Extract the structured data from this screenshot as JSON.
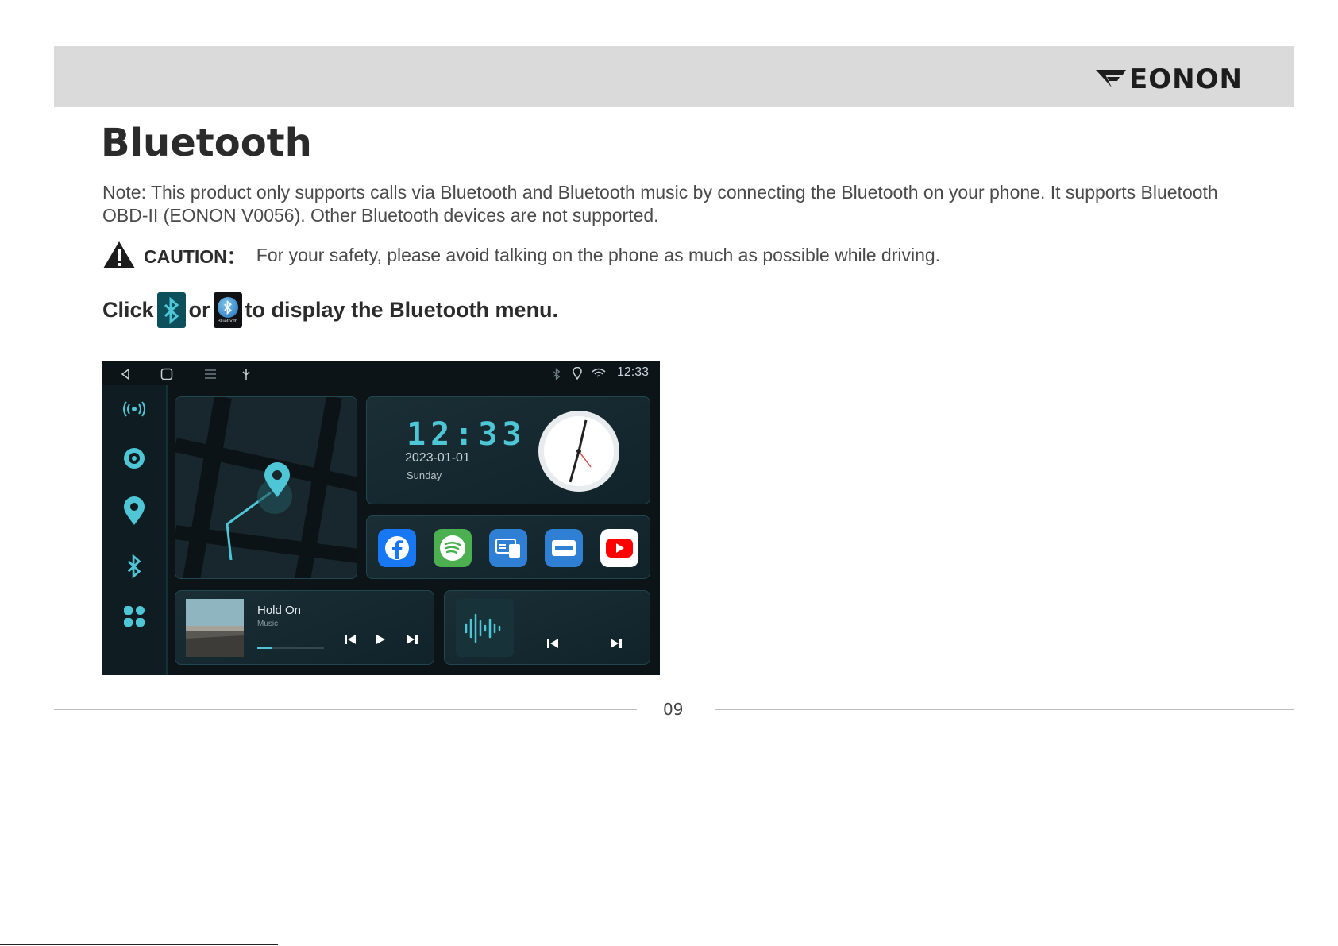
{
  "header": {
    "brand": "EONON"
  },
  "title": "Bluetooth",
  "note": "Note: This product only supports calls via Bluetooth and Bluetooth music by connecting the Bluetooth on your phone. It supports Bluetooth OBD-II (EONON V0056). Other Bluetooth devices are not supported.",
  "caution": {
    "label": "CAUTION：",
    "text": "For your safety, please avoid talking on the phone as much as possible while driving."
  },
  "instruction": {
    "click": "Click",
    "or": "or",
    "rest": "to display the Bluetooth menu.",
    "app_caption": "Bluetooth"
  },
  "screen": {
    "status_time": "12:33",
    "clock": {
      "time": "12:33",
      "date": "2023-01-01",
      "day": "Sunday"
    },
    "music": {
      "title": "Hold On",
      "subtitle": "Music"
    },
    "apps": [
      {
        "name": "facebook-app-icon",
        "color": "#1877f2"
      },
      {
        "name": "spotify-app-icon",
        "color": "#1db954"
      },
      {
        "name": "screen-mirror-app-icon",
        "color": "#2f7fd4"
      },
      {
        "name": "netflix-app-icon",
        "color": "#2f7fd4"
      },
      {
        "name": "youtube-app-icon",
        "color": "#ff0000"
      }
    ],
    "accent": "#4ec6d6"
  },
  "page_number": "09"
}
